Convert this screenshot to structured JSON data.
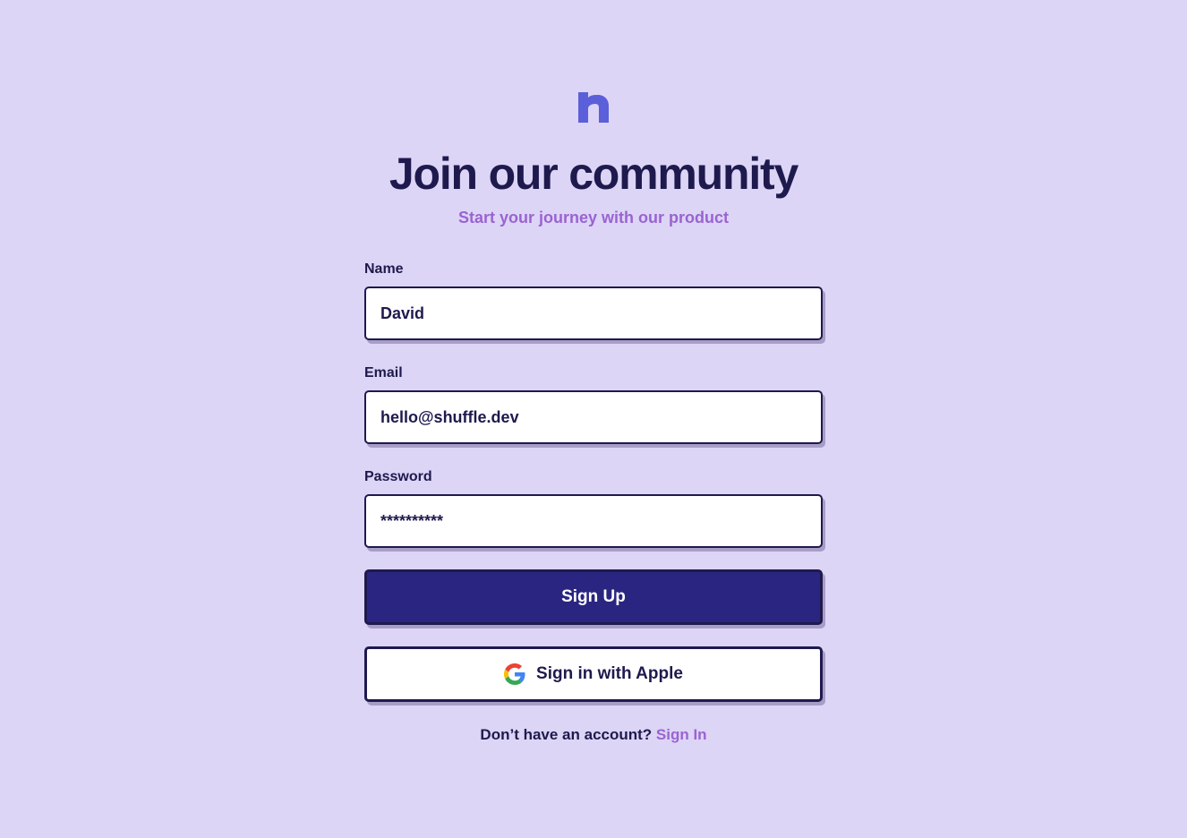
{
  "brand": {
    "logo_icon": "n-logo-icon",
    "logo_color": "#5b5fd9"
  },
  "header": {
    "title": "Join our community",
    "subtitle": "Start your journey with our product"
  },
  "form": {
    "name": {
      "label": "Name",
      "value": "David"
    },
    "email": {
      "label": "Email",
      "value": "hello@shuffle.dev"
    },
    "password": {
      "label": "Password",
      "value": "**********"
    },
    "submit_label": "Sign Up",
    "oauth": {
      "label": "Sign in with Apple",
      "icon": "google-icon"
    }
  },
  "footer": {
    "prompt": "Don’t have an account?",
    "link_label": "Sign In"
  },
  "colors": {
    "background": "#dcd5f6",
    "text": "#1e1a4d",
    "accent": "#9a63d1",
    "primary_button": "#2a2580",
    "shadow": "#a89dc7"
  }
}
